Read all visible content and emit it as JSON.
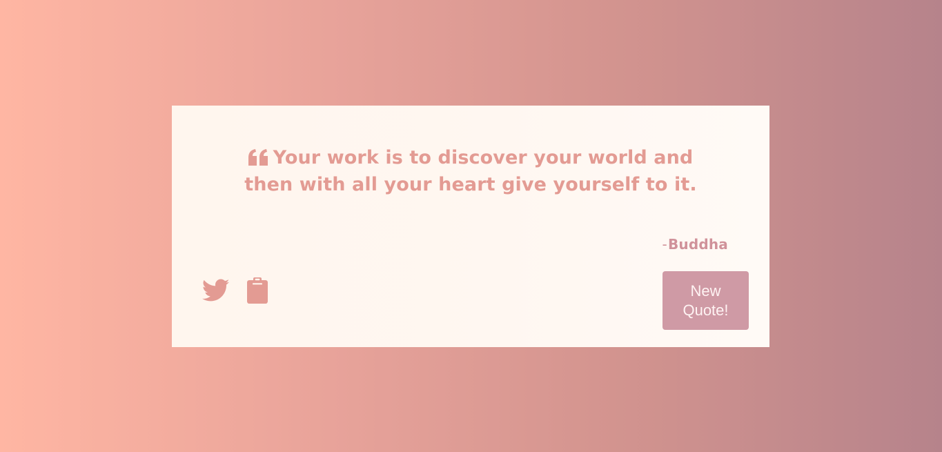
{
  "quote": {
    "text": "Your work is to discover your world and then with all your heart give yourself to it.",
    "author_prefix": "-",
    "author": "Buddha"
  },
  "actions": {
    "share_icons": [
      "twitter-icon",
      "clipboard-icon"
    ],
    "new_quote_label": "New Quote!"
  },
  "colors": {
    "accent": "#e39b93",
    "author_color": "#d0929a",
    "button_bg": "#cf9aa5",
    "card_bg": "#fff6ee",
    "background_left": "#ffb6a3",
    "background_right": "#b6838b"
  }
}
